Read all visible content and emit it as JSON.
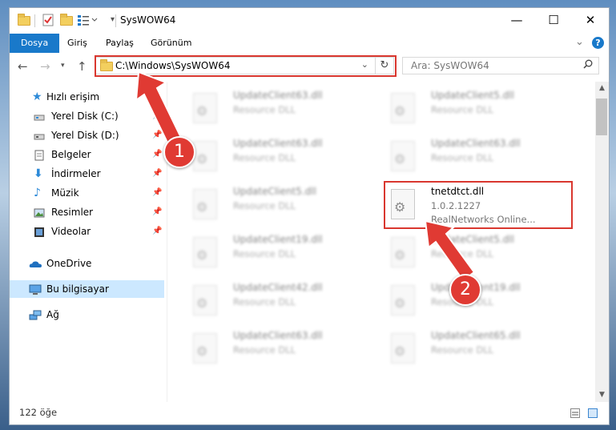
{
  "window": {
    "title": "SysWOW64",
    "minimize_glyph": "—",
    "maximize_glyph": "☐",
    "close_glyph": "✕"
  },
  "ribbon": {
    "tabs": [
      "Dosya",
      "Giriş",
      "Paylaş",
      "Görünüm"
    ],
    "collapse_glyph": "⌄",
    "help_glyph": "?"
  },
  "address": {
    "path": "C:\\Windows\\SysWOW64",
    "search_placeholder": "Ara: SysWOW64"
  },
  "nav": {
    "items": [
      {
        "label": "Hızlı erişim",
        "icon": "star-icon",
        "pinned": false
      },
      {
        "label": "Yerel Disk (C:)",
        "icon": "drive-icon",
        "pinned": true
      },
      {
        "label": "Yerel Disk (D:)",
        "icon": "drive-icon",
        "pinned": true
      },
      {
        "label": "Belgeler",
        "icon": "documents-icon",
        "pinned": true
      },
      {
        "label": "İndirmeler",
        "icon": "download-icon",
        "pinned": true
      },
      {
        "label": "Müzik",
        "icon": "music-icon",
        "pinned": true
      },
      {
        "label": "Resimler",
        "icon": "pictures-icon",
        "pinned": true
      },
      {
        "label": "Videolar",
        "icon": "video-icon",
        "pinned": true
      },
      {
        "label": "OneDrive",
        "icon": "cloud-icon",
        "pinned": false
      },
      {
        "label": "Bu bilgisayar",
        "icon": "computer-icon",
        "pinned": false,
        "selected": true
      },
      {
        "label": "Ağ",
        "icon": "network-icon",
        "pinned": false
      }
    ]
  },
  "files": {
    "left": [
      {
        "name": "UpdateClient63.dll",
        "desc": "Resource DLL"
      },
      {
        "name": "UpdateClient63.dll",
        "desc": "Resource DLL"
      },
      {
        "name": "UpdateClient5.dll",
        "desc": "Resource DLL"
      },
      {
        "name": "UpdateClient19.dll",
        "desc": "Resource DLL"
      },
      {
        "name": "UpdateClient42.dll",
        "desc": "Resource DLL"
      },
      {
        "name": "UpdateClient63.dll",
        "desc": "Resource DLL"
      }
    ],
    "right": [
      {
        "name": "UpdateClient5.dll",
        "desc": "Resource DLL"
      },
      {
        "name": "UpdateClient63.dll",
        "desc": "Resource DLL"
      },
      {
        "name": "tnetdtct.dll",
        "desc": "1.0.2.1227",
        "company": "RealNetworks Online..."
      },
      {
        "name": "UpdateClient5.dll",
        "desc": "Resource DLL"
      },
      {
        "name": "UpdateClient19.dll",
        "desc": "Resource DLL"
      },
      {
        "name": "UpdateClient65.dll",
        "desc": "Resource DLL"
      }
    ]
  },
  "status": {
    "item_count": "122 öğe"
  },
  "annotations": {
    "step1": "1",
    "step2": "2"
  },
  "colors": {
    "accent": "#1979ca",
    "annotation_red": "#d9372f",
    "selection": "#cce8ff"
  }
}
